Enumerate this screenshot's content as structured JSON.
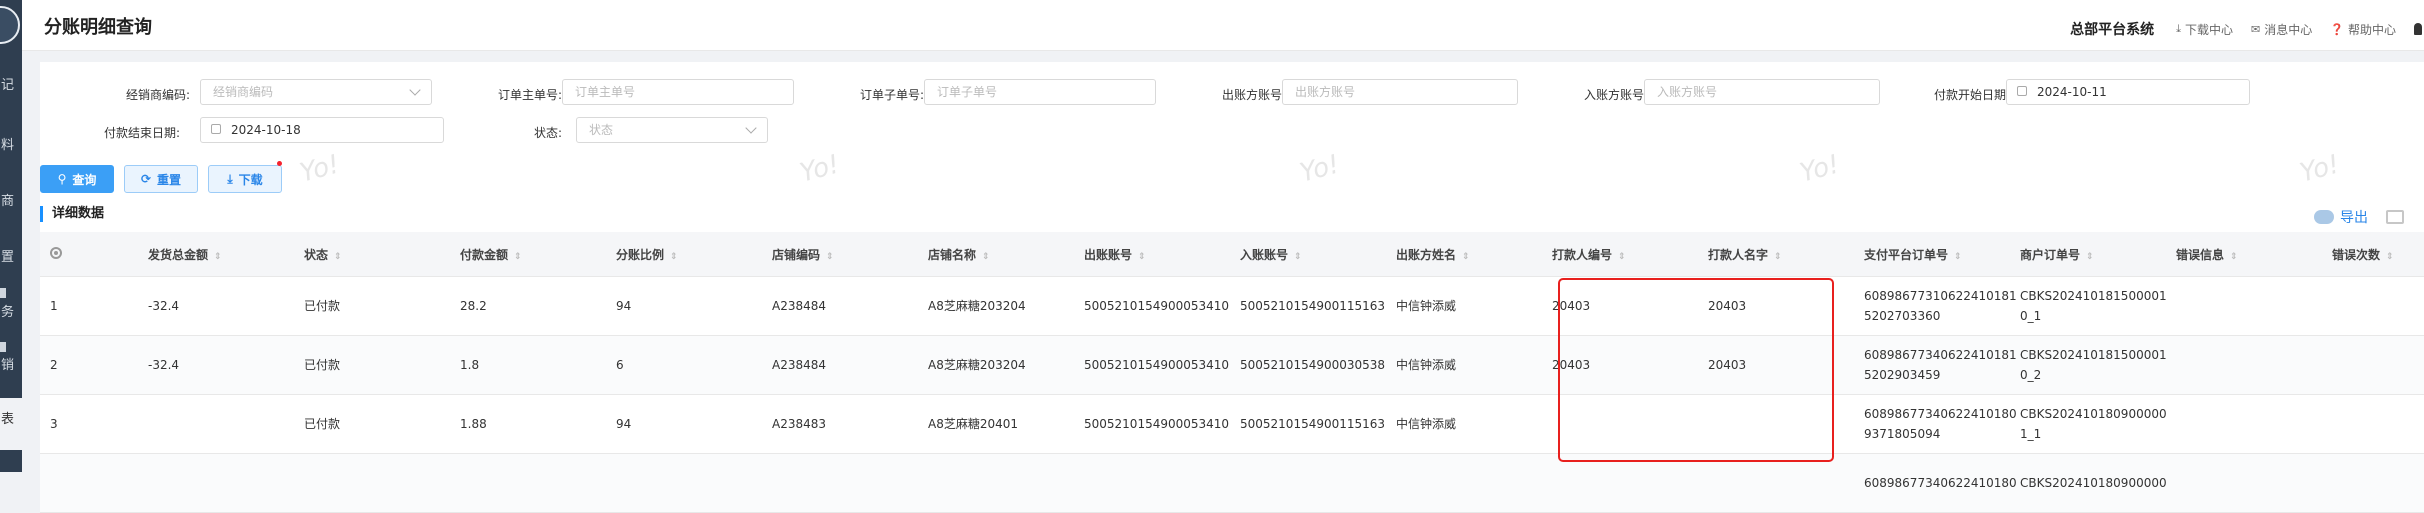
{
  "sidebar": {
    "items": [
      {
        "label": "记"
      },
      {
        "label": "料"
      },
      {
        "label": "商"
      },
      {
        "label": "置"
      },
      {
        "label": "务"
      },
      {
        "label": "销"
      },
      {
        "label": "表"
      }
    ]
  },
  "header": {
    "title": "分账明细查询",
    "platform": "总部平台系统",
    "links": [
      {
        "label": "下载中心",
        "icon": "download-icon"
      },
      {
        "label": "消息中心",
        "icon": "mail-icon"
      },
      {
        "label": "帮助中心",
        "icon": "help-icon"
      }
    ]
  },
  "filters": {
    "dealer_code": {
      "label": "经销商编码:",
      "placeholder": "经销商编码"
    },
    "main_order": {
      "label": "订单主单号:",
      "placeholder": "订单主单号"
    },
    "sub_order": {
      "label": "订单子单号:",
      "placeholder": "订单子单号"
    },
    "out_account": {
      "label": "出账方账号:",
      "placeholder": "出账方账号"
    },
    "in_account": {
      "label": "入账方账号:",
      "placeholder": "入账方账号"
    },
    "pay_start": {
      "label": "付款开始日期:",
      "value": "2024-10-11"
    },
    "pay_end": {
      "label": "付款结束日期:",
      "value": "2024-10-18"
    },
    "status": {
      "label": "状态:",
      "placeholder": "状态"
    }
  },
  "buttons": {
    "query": "查询",
    "reset": "重置",
    "download": "下载"
  },
  "section": {
    "title": "详细数据",
    "export": "导出"
  },
  "watermark": "Yo!",
  "table": {
    "columns": [
      "发货总金额",
      "状态",
      "付款金额",
      "分账比例",
      "店铺编码",
      "店铺名称",
      "出账账号",
      "入账账号",
      "出账方姓名",
      "打款人编号",
      "打款人名字",
      "支付平台订单号",
      "商户订单号",
      "错误信息",
      "错误次数"
    ],
    "rows": [
      {
        "index": "1",
        "ship_total": "-32.4",
        "status": "已付款",
        "pay_amount": "28.2",
        "ratio": "94",
        "shop_code": "A238484",
        "shop_name": "A8芝麻糖203204",
        "out_acct": "5005210154900053410",
        "in_acct": "5005210154900115163",
        "out_name": "中信钟添威",
        "payer_no": "20403",
        "payer_name": "20403",
        "platform_order": "60898677310622410181 5202703360",
        "merchant_order": "CBKS202410181500001 0_1",
        "err_msg": "",
        "err_count": ""
      },
      {
        "index": "2",
        "ship_total": "-32.4",
        "status": "已付款",
        "pay_amount": "1.8",
        "ratio": "6",
        "shop_code": "A238484",
        "shop_name": "A8芝麻糖203204",
        "out_acct": "5005210154900053410",
        "in_acct": "5005210154900030538",
        "out_name": "中信钟添威",
        "payer_no": "20403",
        "payer_name": "20403",
        "platform_order": "60898677340622410181 5202903459",
        "merchant_order": "CBKS202410181500001 0_2",
        "err_msg": "",
        "err_count": ""
      },
      {
        "index": "3",
        "ship_total": "",
        "status": "已付款",
        "pay_amount": "1.88",
        "ratio": "94",
        "shop_code": "A238483",
        "shop_name": "A8芝麻糖20401",
        "out_acct": "5005210154900053410",
        "in_acct": "5005210154900115163",
        "out_name": "中信钟添威",
        "payer_no": "",
        "payer_name": "",
        "platform_order": "60898677340622410180 9371805094",
        "merchant_order": "CBKS202410180900000 1_1",
        "err_msg": "",
        "err_count": ""
      },
      {
        "index": "",
        "ship_total": "",
        "status": "",
        "pay_amount": "",
        "ratio": "",
        "shop_code": "",
        "shop_name": "",
        "out_acct": "",
        "in_acct": "",
        "out_name": "",
        "payer_no": "",
        "payer_name": "",
        "platform_order": "60898677340622410180",
        "merchant_order": "CBKS202410180900000",
        "err_msg": "",
        "err_count": ""
      }
    ]
  }
}
